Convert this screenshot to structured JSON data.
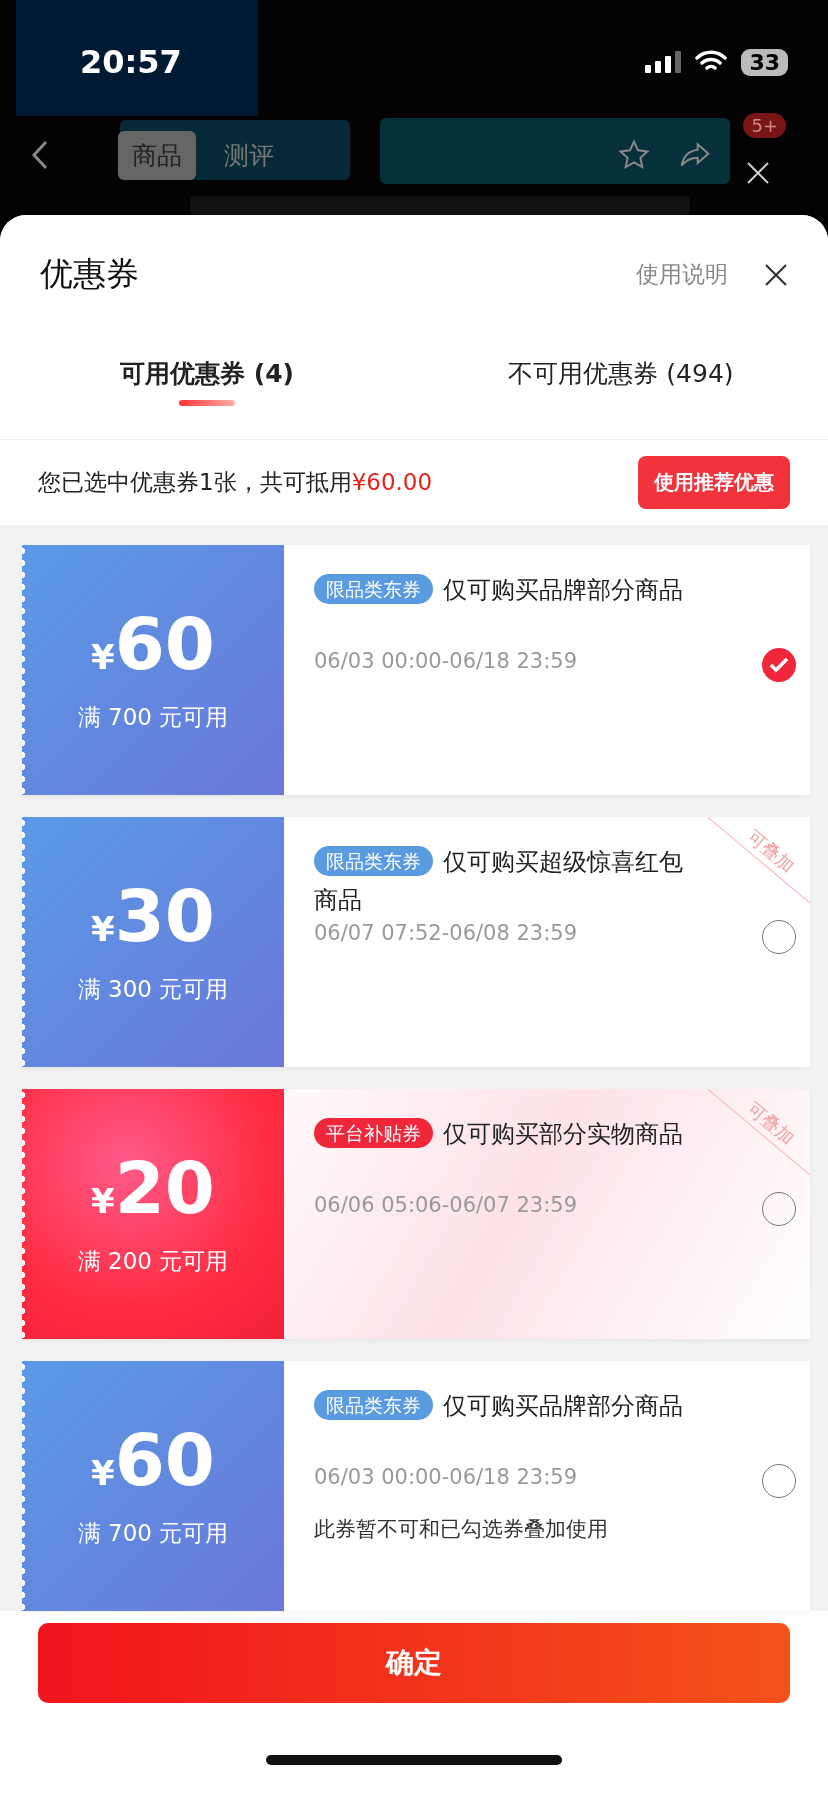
{
  "status_bar": {
    "time": "20:57",
    "battery": "33"
  },
  "product_nav": {
    "tabs": [
      {
        "label": "商品",
        "selected": true
      },
      {
        "label": "测评",
        "selected": false
      }
    ],
    "badge": "5+"
  },
  "sheet": {
    "title": "优惠券",
    "help_link": "使用说明",
    "tabs": [
      {
        "label": "可用优惠券 (4)",
        "selected": true
      },
      {
        "label": "不可用优惠券 (494)",
        "selected": false
      }
    ],
    "summary": {
      "text": "您已选中优惠券1张，共可抵用",
      "amount": "¥60.00",
      "button": "使用推荐优惠"
    },
    "coupons": [
      {
        "kind": "blue",
        "currency": "¥",
        "amount": "60",
        "condition": "满 700 元可用",
        "tag": {
          "label": "限品类东券",
          "kind": "category"
        },
        "description": "仅可购买品牌部分商品",
        "period": "06/03 00:00-06/18 23:59",
        "stackable": false,
        "selected": true
      },
      {
        "kind": "blue",
        "currency": "¥",
        "amount": "30",
        "condition": "满 300 元可用",
        "tag": {
          "label": "限品类东券",
          "kind": "category"
        },
        "description": "仅可购买超级惊喜红包商品",
        "period": "06/07 07:52-06/08 23:59",
        "stackable": true,
        "stack_label": "可叠加",
        "selected": false
      },
      {
        "kind": "red",
        "currency": "¥",
        "amount": "20",
        "condition": "满 200 元可用",
        "tag": {
          "label": "平台补贴券",
          "kind": "platform"
        },
        "description": "仅可购买部分实物商品",
        "period": "06/06 05:06-06/07 23:59",
        "stackable": true,
        "stack_label": "可叠加",
        "selected": false
      },
      {
        "kind": "blue",
        "currency": "¥",
        "amount": "60",
        "condition": "满 700 元可用",
        "tag": {
          "label": "限品类东券",
          "kind": "category"
        },
        "description": "仅可购买品牌部分商品",
        "period": "06/03 00:00-06/18 23:59",
        "note": "此券暂不可和已勾选券叠加使用",
        "stackable": false,
        "selected": false
      }
    ],
    "confirm": "确定"
  }
}
